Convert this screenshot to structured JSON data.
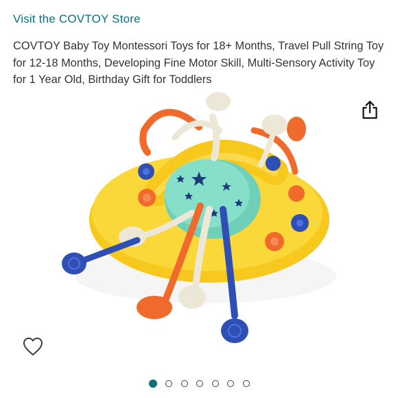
{
  "store": {
    "link_label": "Visit the COVTOY Store"
  },
  "product": {
    "title": "COVTOY Baby Toy Montessori Toys for 18+ Months, Travel Pull String Toy for 12-18 Months, Developing Fine Motor Skill, Multi-Sensory Activity Toy for 1 Year Old, Birthday Gift for Toddlers"
  },
  "gallery": {
    "image_count": 7,
    "active_index": 0,
    "share_icon": "share-icon",
    "wishlist_icon": "heart-icon"
  },
  "colors": {
    "link": "#0f6f7f",
    "active_dot": "#0f6f7f",
    "toy_yellow": "#f9d42a",
    "toy_mint": "#7ed9c3",
    "toy_orange": "#ef6a2b",
    "toy_blue": "#2f4fb5",
    "toy_cream": "#ede7d8"
  }
}
